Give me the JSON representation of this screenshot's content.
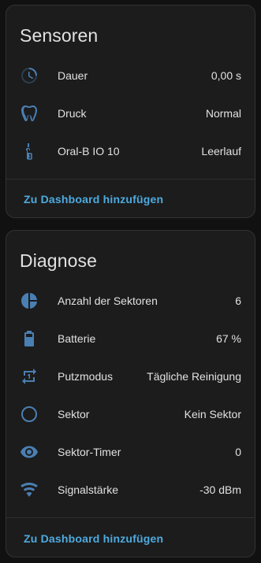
{
  "colors": {
    "icon": "#4a7fb3",
    "accent": "#4dabe0",
    "card_bg": "#1c1c1c",
    "page_bg": "#111111"
  },
  "sensoren": {
    "title": "Sensoren",
    "rows": [
      {
        "icon": "timer-outline-icon",
        "label": "Dauer",
        "value": "0,00 s"
      },
      {
        "icon": "tooth-icon",
        "label": "Druck",
        "value": "Normal"
      },
      {
        "icon": "toothbrush-electric-icon",
        "label": "Oral-B IO 10",
        "value": "Leerlauf"
      }
    ],
    "action": "Zu Dashboard hinzufügen"
  },
  "diagnose": {
    "title": "Diagnose",
    "rows": [
      {
        "icon": "chart-pie-icon",
        "label": "Anzahl der Sektoren",
        "value": "6"
      },
      {
        "icon": "battery-icon",
        "label": "Batterie",
        "value": "67 %"
      },
      {
        "icon": "repeat-once-icon",
        "label": "Putzmodus",
        "value": "Tägliche Reinigung"
      },
      {
        "icon": "circle-outline-icon",
        "label": "Sektor",
        "value": "Kein Sektor"
      },
      {
        "icon": "eye-icon",
        "label": "Sektor-Timer",
        "value": "0"
      },
      {
        "icon": "wifi-icon",
        "label": "Signalstärke",
        "value": "-30 dBm"
      }
    ],
    "action": "Zu Dashboard hinzufügen"
  }
}
